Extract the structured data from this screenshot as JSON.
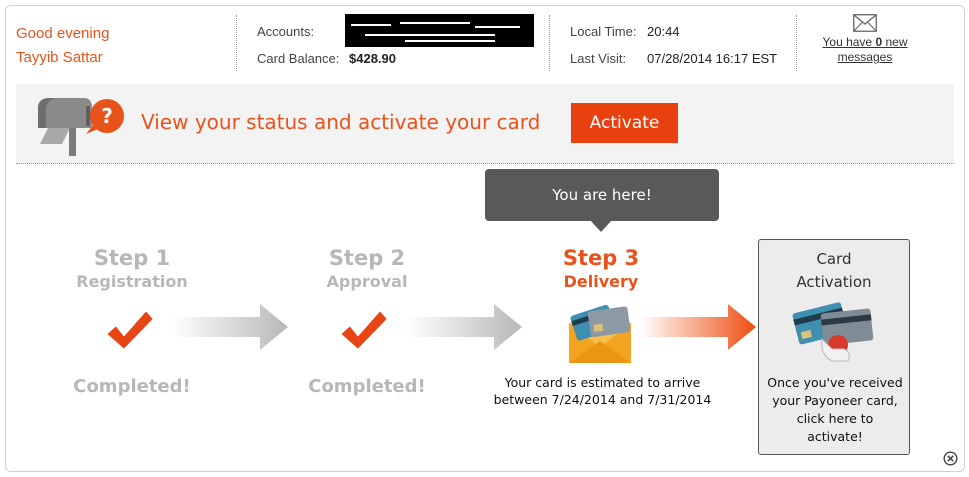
{
  "header": {
    "greeting": "Good evening",
    "user_name": "Tayyib Sattar",
    "accounts_label": "Accounts:",
    "card_balance_label": "Card Balance:",
    "card_balance_value": "$428.90",
    "local_time_label": "Local Time:",
    "local_time_value": "20:44",
    "last_visit_label": "Last Visit:",
    "last_visit_value": "07/28/2014 16:17 EST",
    "messages_prefix": "You have ",
    "messages_count": "0",
    "messages_suffix_1": " new",
    "messages_suffix_2": "messages",
    "envelope_icon": "envelope-icon"
  },
  "banner": {
    "icon": "mailbox-question-icon",
    "title": "View your status and activate your card",
    "activate_label": "Activate"
  },
  "tooltip": {
    "text": "You are here!"
  },
  "steps": [
    {
      "number": "Step 1",
      "name": "Registration",
      "status": "Completed!",
      "state": "done"
    },
    {
      "number": "Step 2",
      "name": "Approval",
      "status": "Completed!",
      "state": "done"
    },
    {
      "number": "Step 3",
      "name": "Delivery",
      "status": "",
      "state": "current"
    }
  ],
  "delivery_note": {
    "line1": "Your card is estimated to arrive",
    "line2": "between 7/24/2014 and 7/31/2014"
  },
  "card_activation": {
    "title_line1": "Card",
    "title_line2": "Activation",
    "desc_line1": "Once you've received",
    "desc_line2": "your Payoneer card,",
    "desc_line3": "click here to",
    "desc_line4": "activate!"
  },
  "colors": {
    "accent": "#e8531c",
    "button": "#e8400f",
    "inactive": "#b7b7b7",
    "tooltip": "#595959"
  }
}
